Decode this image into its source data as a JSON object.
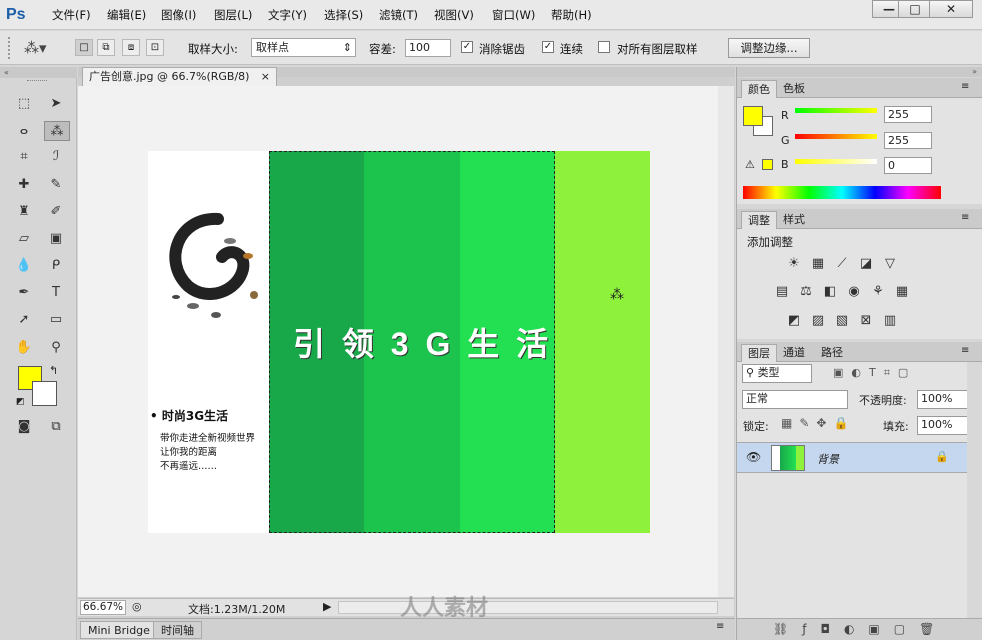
{
  "app": {
    "logo": "Ps"
  },
  "menu": [
    "文件(F)",
    "编辑(E)",
    "图像(I)",
    "图层(L)",
    "文字(Y)",
    "选择(S)",
    "滤镜(T)",
    "视图(V)",
    "窗口(W)",
    "帮助(H)"
  ],
  "window_buttons": {
    "minimize": "—",
    "maximize": "□",
    "close": "✕"
  },
  "options": {
    "sample_size_label": "取样大小:",
    "sample_size_value": "取样点",
    "tolerance_label": "容差:",
    "tolerance_value": "100",
    "antialias_label": "消除锯齿",
    "contiguous_label": "连续",
    "all_layers_label": "对所有图层取样",
    "refine_edge_label": "调整边缘..."
  },
  "document": {
    "tab_title": "广告创意.jpg @ 66.7%(RGB/8)",
    "close_glyph": "×",
    "headline": "引 领 3 G 生 活",
    "side_title": "• 时尚3G生活",
    "side_lines": [
      "带你走进全新视频世界",
      "让你我的距离",
      "不再遥远……"
    ],
    "stripe_colors": [
      "#18a84a",
      "#1cc44e",
      "#22e052",
      "#8ef23c"
    ]
  },
  "status": {
    "zoom": "66.67%",
    "doc_info": "文档:1.23M/1.20M"
  },
  "bottom_tabs": [
    "Mini Bridge",
    "时间轴"
  ],
  "color_panel": {
    "tabs": [
      "颜色",
      "色板"
    ],
    "r_label": "R",
    "g_label": "G",
    "b_label": "B",
    "r_value": "255",
    "g_value": "255",
    "b_value": "0",
    "foreground": "#ffff00",
    "background": "#ffffff"
  },
  "adjust_panel": {
    "tabs": [
      "调整",
      "样式"
    ],
    "title": "添加调整"
  },
  "layers_panel": {
    "tabs": [
      "图层",
      "通道",
      "路径"
    ],
    "filter_label": "类型",
    "blend_mode": "正常",
    "opacity_label": "不透明度:",
    "opacity_value": "100%",
    "lock_label": "锁定:",
    "fill_label": "填充:",
    "fill_value": "100%",
    "layer_name": "背景"
  },
  "watermark": "人人素材"
}
